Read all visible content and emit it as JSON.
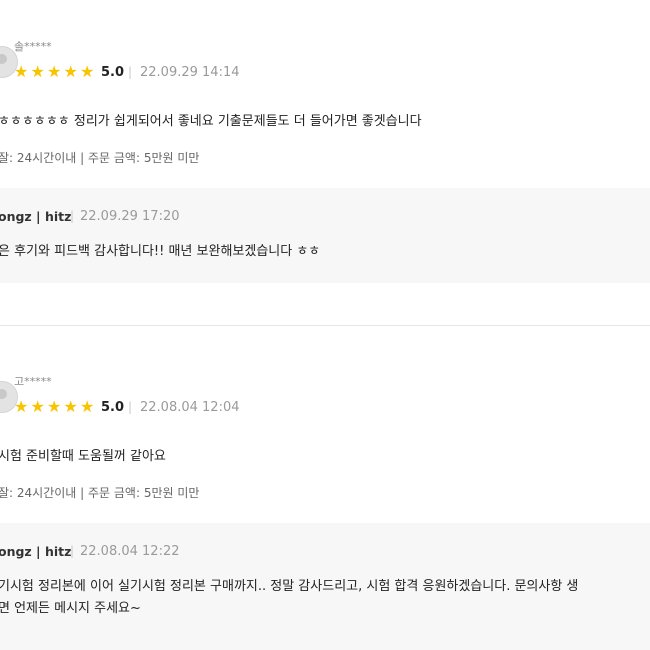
{
  "reviews": [
    {
      "username": "솔*****",
      "stars": "★★★★★",
      "score": "5.0",
      "separator": "|",
      "date": "22.09.29 14:14",
      "content": "ㅎㅎㅎㅎㅎㅎ 정리가 쉽게되어서 좋네요 기출문제들도 더 들어가면 좋겟습니다",
      "meta": "잘: 24시간이내 | 주문 금액: 5만원 미만",
      "reply": {
        "seller": "ongz | hitz",
        "separator": "|",
        "date": "22.09.29 17:20",
        "lines": [
          "은 후기와 피드백 감사합니다!! 매년 보완해보겠습니다 ㅎㅎ"
        ]
      }
    },
    {
      "username": "고*****",
      "stars": "★★★★★",
      "score": "5.0",
      "separator": "|",
      "date": "22.08.04 12:04",
      "content": "시험 준비할때 도움될꺼 같아요",
      "meta": "잘: 24시간이내 | 주문 금액: 5만원 미만",
      "reply": {
        "seller": "ongz | hitz",
        "separator": "|",
        "date": "22.08.04 12:22",
        "lines": [
          "기시험 정리본에 이어 실기시험 정리본 구매까지..  정말 감사드리고, 시험 합격 응원하겠습니다. 문의사항 생",
          "면 언제든 메시지 주세요~"
        ]
      }
    }
  ],
  "rating_value": 5.0,
  "star_color": "#f8c400"
}
